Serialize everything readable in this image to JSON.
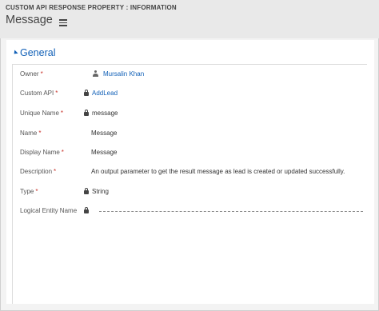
{
  "header": {
    "entity_type": "CUSTOM API RESPONSE PROPERTY : INFORMATION",
    "record_title": "Message",
    "background": "#e9e9e9"
  },
  "section": {
    "title": "General",
    "accent_color": "#1160b7"
  },
  "fields": {
    "owner": {
      "label": "Owner",
      "required": "*",
      "value": "Mursalin Khan",
      "icon": "person-icon"
    },
    "custom_api": {
      "label": "Custom API",
      "required": "*",
      "value": "AddLead",
      "icon": "lock-icon"
    },
    "unique_name": {
      "label": "Unique Name",
      "required": "*",
      "value": "message",
      "icon": "lock-icon"
    },
    "name": {
      "label": "Name",
      "required": "*",
      "value": "Message"
    },
    "display_name": {
      "label": "Display Name",
      "required": "*",
      "value": "Message"
    },
    "description": {
      "label": "Description",
      "required": "*",
      "value": "An output parameter to get the result message as lead is created or updated successfully."
    },
    "type": {
      "label": "Type",
      "required": "*",
      "value": "String",
      "icon": "lock-icon"
    },
    "logical_entity_name": {
      "label": "Logical Entity Name",
      "value": "",
      "icon": "lock-icon"
    }
  },
  "colors": {
    "required": "#c8332b",
    "link": "#1160b7"
  }
}
